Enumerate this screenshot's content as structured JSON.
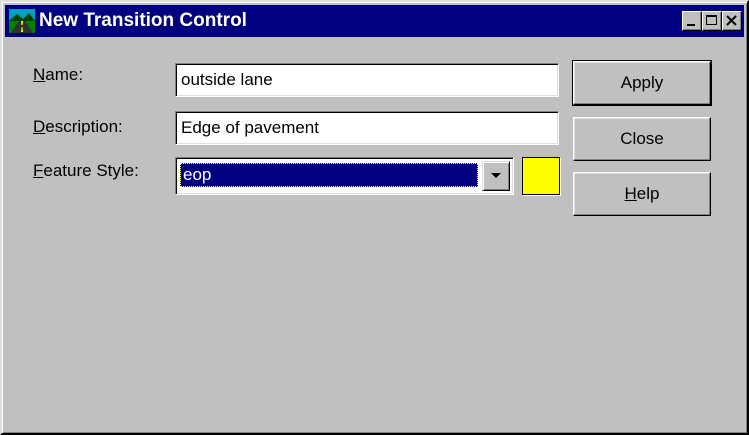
{
  "window": {
    "title": "New Transition Control",
    "icon": "app-road-icon",
    "controls": {
      "minimize": "minimize-icon",
      "maximize": "maximize-icon",
      "close": "close-icon"
    }
  },
  "form": {
    "name": {
      "label_mnemonic": "N",
      "label_rest": "ame:",
      "value": "outside lane"
    },
    "description": {
      "label_mnemonic": "D",
      "label_rest": "escription:",
      "value": "Edge of pavement"
    },
    "feature_style": {
      "label_mnemonic": "F",
      "label_rest": "eature Style:",
      "value": "eop",
      "color": "#ffff00"
    }
  },
  "buttons": {
    "apply": {
      "label": "Apply"
    },
    "close": {
      "label": "Close"
    },
    "help": {
      "label_mnemonic": "H",
      "label_rest": "elp"
    }
  },
  "colors": {
    "titlebar": "#000080",
    "face": "#c0c0c0",
    "selection": "#000080",
    "swatch": "#ffff00"
  }
}
